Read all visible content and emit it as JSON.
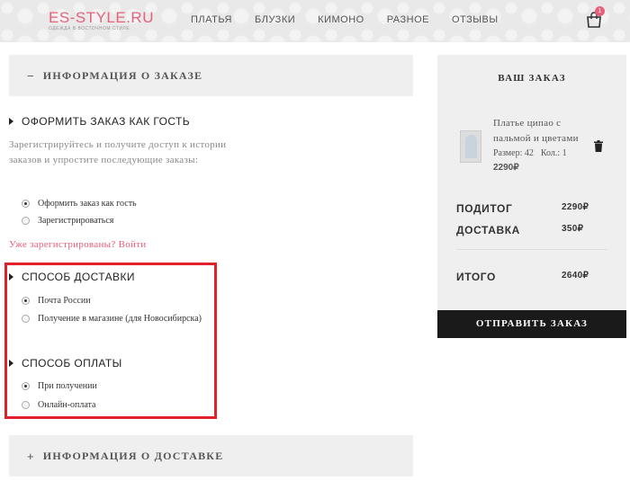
{
  "header": {
    "logo": "ES-STYLE.RU",
    "tagline": "ОДЕЖДА В ВОСТОЧНОМ СТИЛЕ",
    "nav": [
      "ПЛАТЬЯ",
      "БЛУЗКИ",
      "КИМОНО",
      "РАЗНОЕ",
      "ОТЗЫВЫ"
    ],
    "cart_count": "1",
    "colors": {
      "brand": "#e8607a",
      "header_bg": "#e9e9e9"
    }
  },
  "order_info": {
    "symbol": "−",
    "title": "ИНФОРМАЦИЯ О ЗАКАЗЕ"
  },
  "guest": {
    "title": "ОФОРМИТЬ ЗАКАЗ КАК ГОСТЬ",
    "description": "Зарегистрируйтесь и получите доступ к истории заказов и упростите последующие заказы:",
    "options": [
      "Оформить заказ как гость",
      "Зарегистрироваться"
    ],
    "selected": 0,
    "login_link": "Уже зарегистрированы? Войти"
  },
  "delivery": {
    "title": "СПОСОБ ДОСТАВКИ",
    "options": [
      "Почта России",
      "Получение в магазине (для Новосибирска)"
    ],
    "selected": 0
  },
  "payment": {
    "title": "СПОСОБ ОПЛАТЫ",
    "options": [
      "При получении",
      "Онлайн-оплата"
    ],
    "selected": 0
  },
  "delivery_info": {
    "symbol": "+",
    "title": "ИНФОРМАЦИЯ О ДОСТАВКЕ"
  },
  "order": {
    "title": "ВАШ ЗАКАЗ",
    "product": {
      "name": "Платье ципао с пальмой и цветами",
      "size": "Размер: 42",
      "qty": "Кол.: 1",
      "price": "2290₽"
    },
    "subtotal_label": "ПОДИТОГ",
    "subtotal": "2290₽",
    "shipping_label": "ДОСТАВКА",
    "shipping": "350₽",
    "total_label": "ИТОГО",
    "total": "2640₽",
    "submit": "ОТПРАВИТЬ ЗАКАЗ"
  },
  "highlight_color": "#e0202a"
}
